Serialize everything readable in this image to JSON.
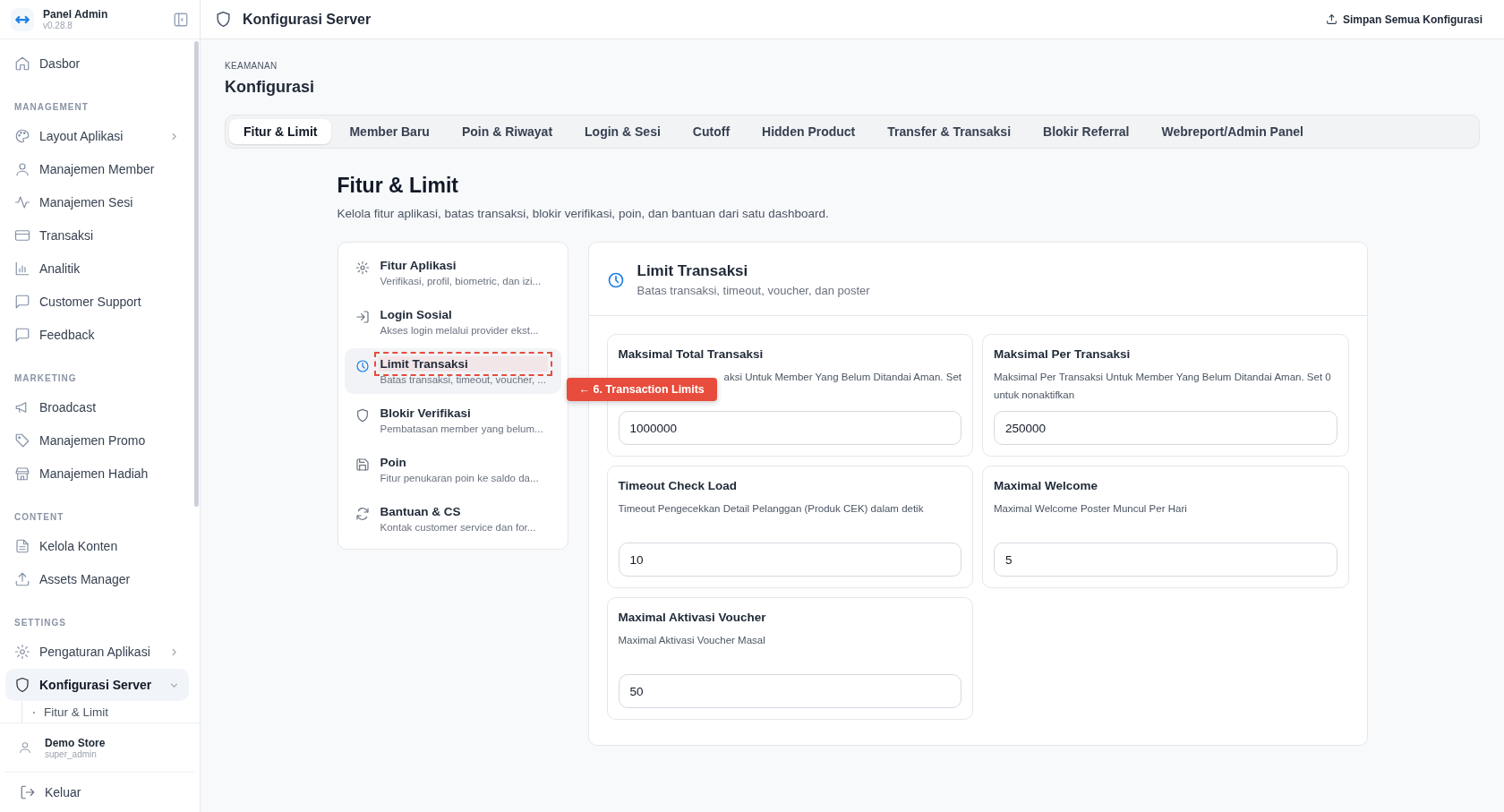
{
  "sidebar": {
    "app_name": "Panel Admin",
    "version": "v0.28.8",
    "sections": [
      {
        "items": [
          {
            "label": "Dasbor",
            "selected": false,
            "expandable": false,
            "expanded": false
          }
        ]
      },
      {
        "heading": "MANAGEMENT",
        "items": [
          {
            "label": "Layout Aplikasi",
            "selected": false,
            "expandable": true,
            "expanded": false
          },
          {
            "label": "Manajemen Member",
            "selected": false,
            "expandable": false,
            "expanded": false
          },
          {
            "label": "Manajemen Sesi",
            "selected": false,
            "expandable": false,
            "expanded": false
          },
          {
            "label": "Transaksi",
            "selected": false,
            "expandable": false,
            "expanded": false
          },
          {
            "label": "Analitik",
            "selected": false,
            "expandable": false,
            "expanded": false
          },
          {
            "label": "Customer Support",
            "selected": false,
            "expandable": false,
            "expanded": false
          },
          {
            "label": "Feedback",
            "selected": false,
            "expandable": false,
            "expanded": false
          }
        ]
      },
      {
        "heading": "MARKETING",
        "items": [
          {
            "label": "Broadcast",
            "selected": false,
            "expandable": false,
            "expanded": false
          },
          {
            "label": "Manajemen Promo",
            "selected": false,
            "expandable": false,
            "expanded": false
          },
          {
            "label": "Manajemen Hadiah",
            "selected": false,
            "expandable": false,
            "expanded": false
          }
        ]
      },
      {
        "heading": "CONTENT",
        "items": [
          {
            "label": "Kelola Konten",
            "selected": false,
            "expandable": false,
            "expanded": false
          },
          {
            "label": "Assets Manager",
            "selected": false,
            "expandable": false,
            "expanded": false
          }
        ]
      },
      {
        "heading": "SETTINGS",
        "items": [
          {
            "label": "Pengaturan Aplikasi",
            "selected": false,
            "expandable": true,
            "expanded": false
          },
          {
            "label": "Konfigurasi Server",
            "selected": true,
            "expandable": true,
            "expanded": true,
            "children": [
              {
                "label": "Fitur & Limit"
              }
            ]
          }
        ]
      }
    ],
    "user": {
      "name": "Demo Store",
      "role": "super_admin"
    },
    "logout": "Keluar"
  },
  "header": {
    "title": "Konfigurasi Server",
    "action": "Simpan Semua Konfigurasi"
  },
  "breadcrumb": "KEAMANAN",
  "page_title": "Konfigurasi",
  "tabs": [
    {
      "label": "Fitur & Limit",
      "selected": true
    },
    {
      "label": "Member Baru",
      "selected": false
    },
    {
      "label": "Poin & Riwayat",
      "selected": false
    },
    {
      "label": "Login & Sesi",
      "selected": false
    },
    {
      "label": "Cutoff",
      "selected": false
    },
    {
      "label": "Hidden Product",
      "selected": false
    },
    {
      "label": "Transfer & Transaksi",
      "selected": false
    },
    {
      "label": "Blokir Referral",
      "selected": false
    },
    {
      "label": "Webreport/Admin Panel",
      "selected": false
    }
  ],
  "section": {
    "title": "Fitur & Limit",
    "subtitle": "Kelola fitur aplikasi, batas transaksi, blokir verifikasi, poin, dan bantuan dari satu dashboard."
  },
  "nav": [
    {
      "title": "Fitur Aplikasi",
      "description": "Verifikasi, profil, biometric, dan izi...",
      "selected": false,
      "highlighted": false
    },
    {
      "title": "Login Sosial",
      "description": "Akses login melalui provider ekst...",
      "selected": false,
      "highlighted": false
    },
    {
      "title": "Limit Transaksi",
      "description": "Batas transaksi, timeout, voucher, ...",
      "selected": true,
      "highlighted": true
    },
    {
      "title": "Blokir Verifikasi",
      "description": "Pembatasan member yang belum...",
      "selected": false,
      "highlighted": false
    },
    {
      "title": "Poin",
      "description": "Fitur penukaran poin ke saldo da...",
      "selected": false,
      "highlighted": false
    },
    {
      "title": "Bantuan & CS",
      "description": "Kontak customer service dan for...",
      "selected": false,
      "highlighted": false
    }
  ],
  "panel": {
    "title": "Limit Transaksi",
    "subtitle": "Batas transaksi, timeout, voucher, dan poster",
    "fields": [
      {
        "label": "Maksimal Total Transaksi",
        "description": "aksi Untuk Member Yang Belum Ditandai Aman. Set",
        "value": "1000000",
        "covered": true
      },
      {
        "label": "Maksimal Per Transaksi",
        "description": "Maksimal Per Transaksi Untuk Member Yang Belum Ditandai Aman. Set 0 untuk nonaktifkan",
        "value": "250000",
        "covered": false
      },
      {
        "label": "Timeout Check Load",
        "description": "Timeout Pengecekkan Detail Pelanggan (Produk CEK) dalam detik",
        "value": "10",
        "covered": false
      },
      {
        "label": "Maximal Welcome",
        "description": "Maximal Welcome Poster Muncul Per Hari",
        "value": "5",
        "covered": false
      },
      {
        "label": "Maximal Aktivasi Voucher",
        "description": "Maximal Aktivasi Voucher Masal",
        "value": "50",
        "covered": false
      }
    ]
  },
  "annotation": {
    "label": "← 6. Transaction Limits"
  }
}
